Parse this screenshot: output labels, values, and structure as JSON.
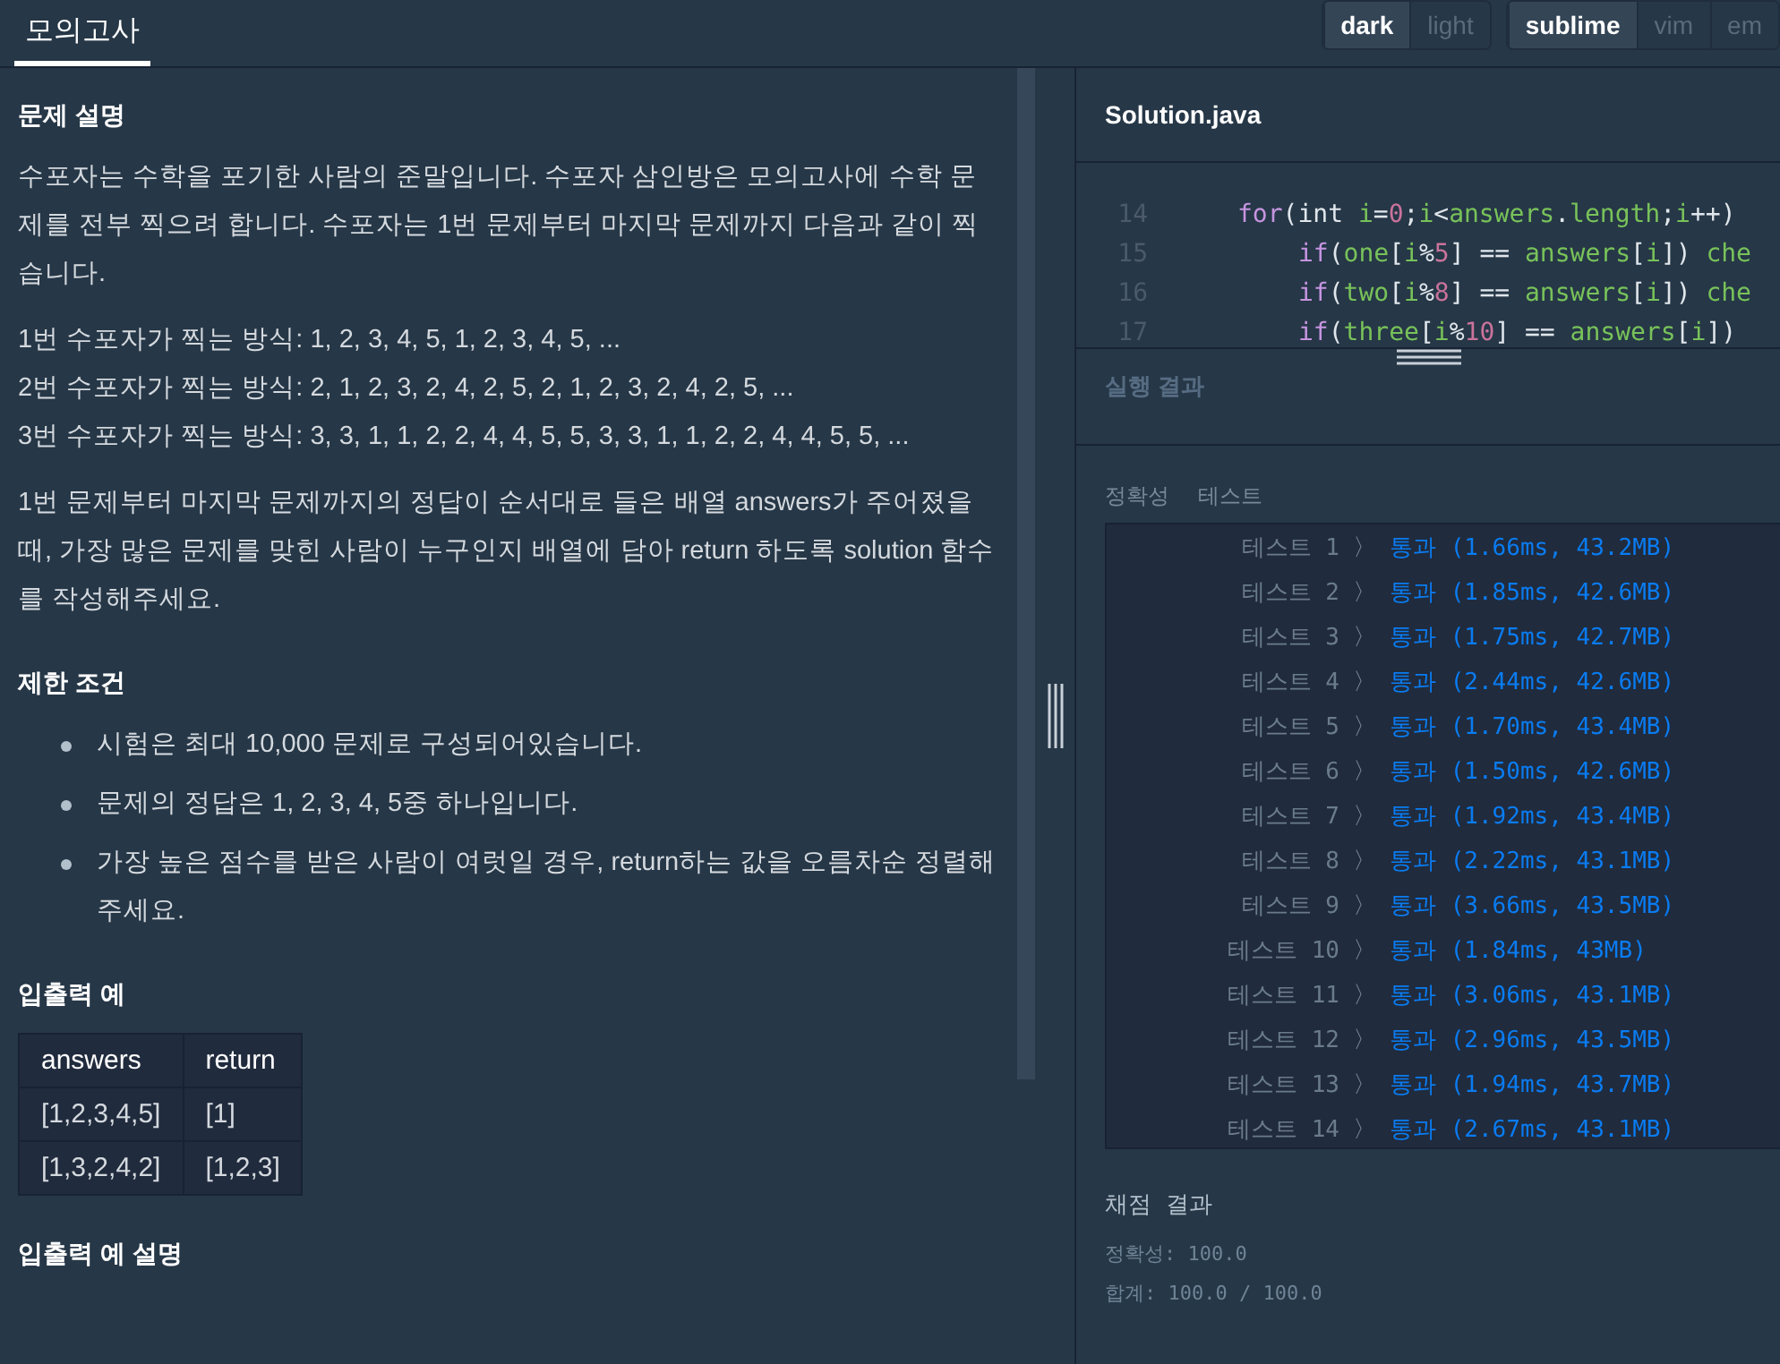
{
  "header": {
    "tab": {
      "label": "모의고사",
      "selected": true
    },
    "theme_toggle": [
      {
        "label": "dark",
        "selected": true
      },
      {
        "label": "light",
        "selected": false
      }
    ],
    "keymap_toggle": [
      {
        "label": "sublime",
        "selected": true
      },
      {
        "label": "vim",
        "selected": false
      },
      {
        "label": "em",
        "selected": false
      }
    ]
  },
  "problem": {
    "sections": [
      {
        "heading": "문제 설명",
        "blocks": [
          {
            "kind": "paragraph",
            "lines": [
              "수포자는 수학을 포기한 사람의 준말입니다. 수포자 삼인방은 모의고사에 수학 문제를 전부 찍으려 합니다. 수포자는 1번 문제부터 마지막 문제까지 다음과 같이 찍습니다."
            ]
          },
          {
            "kind": "paragraph",
            "lines": [
              "1번 수포자가 찍는 방식: 1, 2, 3, 4, 5, 1, 2, 3, 4, 5, ...",
              "2번 수포자가 찍는 방식: 2, 1, 2, 3, 2, 4, 2, 5, 2, 1, 2, 3, 2, 4, 2, 5, ...",
              "3번 수포자가 찍는 방식: 3, 3, 1, 1, 2, 2, 4, 4, 5, 5, 3, 3, 1, 1, 2, 2, 4, 4, 5, 5, ..."
            ]
          },
          {
            "kind": "paragraph",
            "lines": [
              "1번 문제부터 마지막 문제까지의 정답이 순서대로 들은 배열 answers가 주어졌을 때, 가장 많은 문제를 맞힌 사람이 누구인지 배열에 담아 return 하도록 solution 함수를 작성해주세요."
            ]
          }
        ]
      },
      {
        "heading": "제한 조건",
        "blocks": [
          {
            "kind": "bullets",
            "lines": [
              "시험은 최대 10,000 문제로 구성되어있습니다.",
              "문제의 정답은 1, 2, 3, 4, 5중 하나입니다.",
              "가장 높은 점수를 받은 사람이 여럿일 경우, return하는 값을 오름차순 정렬해주세요."
            ]
          }
        ]
      },
      {
        "heading": "입출력 예",
        "blocks": [
          {
            "kind": "table",
            "columns": [
              "answers",
              "return"
            ],
            "rows": [
              [
                "[1,2,3,4,5]",
                "[1]"
              ],
              [
                "[1,3,2,4,2]",
                "[1,2,3]"
              ]
            ]
          }
        ]
      },
      {
        "heading": "입출력 예 설명"
      }
    ]
  },
  "editor": {
    "filename": "Solution.java",
    "lines": [
      {
        "number": "14",
        "tokens": [
          {
            "kind": "keyword",
            "text": "for"
          },
          {
            "kind": "plain",
            "text": "(int "
          },
          {
            "kind": "var",
            "text": "i"
          },
          {
            "kind": "plain",
            "text": "="
          },
          {
            "kind": "number",
            "text": "0"
          },
          {
            "kind": "plain",
            "text": ";"
          },
          {
            "kind": "var",
            "text": "i"
          },
          {
            "kind": "plain",
            "text": "<"
          },
          {
            "kind": "var",
            "text": "answers"
          },
          {
            "kind": "plain",
            "text": "."
          },
          {
            "kind": "var",
            "text": "length"
          },
          {
            "kind": "plain",
            "text": ";"
          },
          {
            "kind": "var",
            "text": "i"
          },
          {
            "kind": "plain",
            "text": "++)"
          }
        ],
        "children": [
          {
            "number": "15",
            "tokens": [
              {
                "kind": "keyword",
                "text": "if"
              },
              {
                "kind": "plain",
                "text": "("
              },
              {
                "kind": "var",
                "text": "one"
              },
              {
                "kind": "plain",
                "text": "["
              },
              {
                "kind": "var",
                "text": "i"
              },
              {
                "kind": "plain",
                "text": "%"
              },
              {
                "kind": "number",
                "text": "5"
              },
              {
                "kind": "plain",
                "text": "] == "
              },
              {
                "kind": "var",
                "text": "answers"
              },
              {
                "kind": "plain",
                "text": "["
              },
              {
                "kind": "var",
                "text": "i"
              },
              {
                "kind": "plain",
                "text": "]) "
              },
              {
                "kind": "var",
                "text": "che"
              }
            ]
          },
          {
            "number": "16",
            "tokens": [
              {
                "kind": "keyword",
                "text": "if"
              },
              {
                "kind": "plain",
                "text": "("
              },
              {
                "kind": "var",
                "text": "two"
              },
              {
                "kind": "plain",
                "text": "["
              },
              {
                "kind": "var",
                "text": "i"
              },
              {
                "kind": "plain",
                "text": "%"
              },
              {
                "kind": "number",
                "text": "8"
              },
              {
                "kind": "plain",
                "text": "] == "
              },
              {
                "kind": "var",
                "text": "answers"
              },
              {
                "kind": "plain",
                "text": "["
              },
              {
                "kind": "var",
                "text": "i"
              },
              {
                "kind": "plain",
                "text": "]) "
              },
              {
                "kind": "var",
                "text": "che"
              }
            ]
          },
          {
            "number": "17",
            "tokens": [
              {
                "kind": "keyword",
                "text": "if"
              },
              {
                "kind": "plain",
                "text": "("
              },
              {
                "kind": "var",
                "text": "three"
              },
              {
                "kind": "plain",
                "text": "["
              },
              {
                "kind": "var",
                "text": "i"
              },
              {
                "kind": "plain",
                "text": "%"
              },
              {
                "kind": "number",
                "text": "10"
              },
              {
                "kind": "plain",
                "text": "] == "
              },
              {
                "kind": "var",
                "text": "answers"
              },
              {
                "kind": "plain",
                "text": "["
              },
              {
                "kind": "var",
                "text": "i"
              },
              {
                "kind": "plain",
                "text": "])"
              }
            ]
          }
        ]
      }
    ]
  },
  "run_result": {
    "title": "실행 결과"
  },
  "results": {
    "group_label": "정확성",
    "group_title": "테스트",
    "tests": [
      {
        "label": "테스트 1",
        "arrow": "〉",
        "status": "통과",
        "detail": "(1.66ms, 43.2MB)"
      },
      {
        "label": "테스트 2",
        "arrow": "〉",
        "status": "통과",
        "detail": "(1.85ms, 42.6MB)"
      },
      {
        "label": "테스트 3",
        "arrow": "〉",
        "status": "통과",
        "detail": "(1.75ms, 42.7MB)"
      },
      {
        "label": "테스트 4",
        "arrow": "〉",
        "status": "통과",
        "detail": "(2.44ms, 42.6MB)"
      },
      {
        "label": "테스트 5",
        "arrow": "〉",
        "status": "통과",
        "detail": "(1.70ms, 43.4MB)"
      },
      {
        "label": "테스트 6",
        "arrow": "〉",
        "status": "통과",
        "detail": "(1.50ms, 42.6MB)"
      },
      {
        "label": "테스트 7",
        "arrow": "〉",
        "status": "통과",
        "detail": "(1.92ms, 43.4MB)"
      },
      {
        "label": "테스트 8",
        "arrow": "〉",
        "status": "통과",
        "detail": "(2.22ms, 43.1MB)"
      },
      {
        "label": "테스트 9",
        "arrow": "〉",
        "status": "통과",
        "detail": "(3.66ms, 43.5MB)"
      },
      {
        "label": "테스트 10",
        "arrow": "〉",
        "status": "통과",
        "detail": "(1.84ms, 43MB)"
      },
      {
        "label": "테스트 11",
        "arrow": "〉",
        "status": "통과",
        "detail": "(3.06ms, 43.1MB)"
      },
      {
        "label": "테스트 12",
        "arrow": "〉",
        "status": "통과",
        "detail": "(2.96ms, 43.5MB)"
      },
      {
        "label": "테스트 13",
        "arrow": "〉",
        "status": "통과",
        "detail": "(1.94ms, 43.7MB)"
      },
      {
        "label": "테스트 14",
        "arrow": "〉",
        "status": "통과",
        "detail": "(2.67ms, 43.1MB)"
      }
    ],
    "summary_title": "채점 결과",
    "summary": [
      {
        "label": "정확성:",
        "value": "100.0"
      },
      {
        "label": "합계:",
        "value": "100.0 / 100.0"
      }
    ]
  }
}
